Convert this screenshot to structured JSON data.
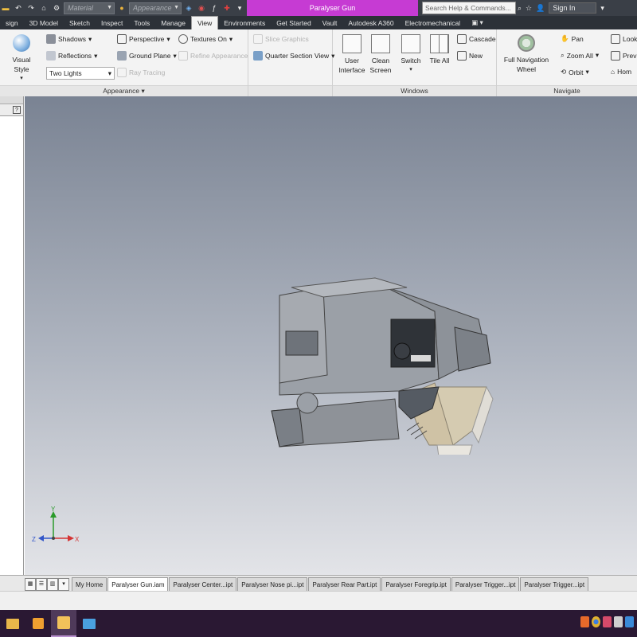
{
  "titlebar": {
    "material_combo": "Material",
    "appearance_combo": "Appearance",
    "window_title": "Paralyser Gun",
    "search_placeholder": "Search Help & Commands...",
    "signin": "Sign In"
  },
  "tabs": [
    "sign",
    "3D Model",
    "Sketch",
    "Inspect",
    "Tools",
    "Manage",
    "View",
    "Environments",
    "Get Started",
    "Vault",
    "Autodesk A360",
    "Electromechanical"
  ],
  "active_tab": "View",
  "ribbon": {
    "appearance": {
      "visual_style": "Visual Style",
      "shadows": "Shadows",
      "reflections": "Reflections",
      "lighting": "Two Lights",
      "perspective": "Perspective",
      "ground_plane": "Ground Plane",
      "ray_tracing": "Ray Tracing",
      "textures_on": "Textures On",
      "refine_appearance": "Refine Appearance",
      "slice_graphics": "Slice Graphics",
      "quarter_section": "Quarter Section View",
      "label": "Appearance"
    },
    "windows": {
      "user_interface_1": "User",
      "user_interface_2": "Interface",
      "clean_screen_1": "Clean",
      "clean_screen_2": "Screen",
      "switch": "Switch",
      "tile_all": "Tile All",
      "cascade": "Cascade",
      "new": "New",
      "label": "Windows"
    },
    "navigate": {
      "full_nav_1": "Full Navigation",
      "full_nav_2": "Wheel",
      "pan": "Pan",
      "zoom_all": "Zoom All",
      "orbit": "Orbit",
      "look_at": "Look",
      "previous": "Previ",
      "home": "Hom",
      "label": "Navigate"
    }
  },
  "triad": {
    "x": "X",
    "y": "Y",
    "z": "Z"
  },
  "doc_tabs": [
    "My Home",
    "Paralyser Gun.iam",
    "Paralyser Center...ipt",
    "Paralyser Nose pi...ipt",
    "Paralyser Rear Part.ipt",
    "Paralyser Foregrip.ipt",
    "Paralyser Trigger...ipt",
    "Paralyser Trigger...ipt"
  ],
  "active_doc_tab": "Paralyser Gun.iam",
  "colors": {
    "title_accent": "#c63bd3",
    "taskbar": "#2a1833",
    "model_gray": "#8e9298",
    "model_grip": "#cfc2a5"
  }
}
